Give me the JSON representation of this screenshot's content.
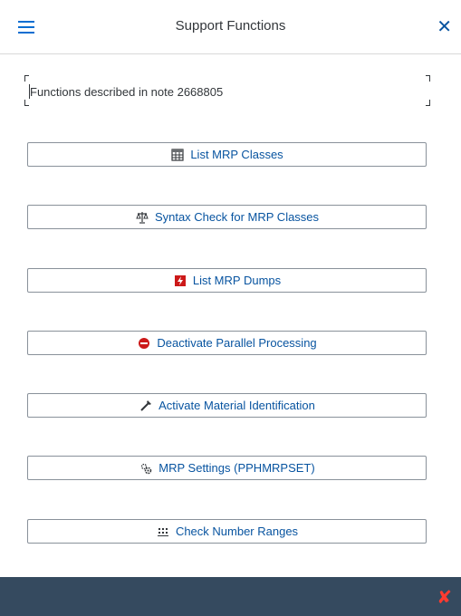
{
  "header": {
    "title": "Support Functions",
    "menu_icon": "hamburger-menu-icon",
    "close_icon": "close-icon",
    "accent": "#0a6ed1"
  },
  "note": {
    "text": "Functions described in note 2668805"
  },
  "buttons": [
    {
      "label": "List MRP Classes",
      "icon": "table-list-icon"
    },
    {
      "label": "Syntax Check for MRP Classes",
      "icon": "scales-icon"
    },
    {
      "label": "List MRP Dumps",
      "icon": "dump-error-icon"
    },
    {
      "label": "Deactivate Parallel Processing",
      "icon": "stop-sign-icon"
    },
    {
      "label": "Activate Material Identification",
      "icon": "wand-icon"
    },
    {
      "label": "MRP Settings (PPHMRPSET)",
      "icon": "gears-icon"
    },
    {
      "label": "Check Number Ranges",
      "icon": "number-range-icon"
    }
  ],
  "footer": {
    "close_icon": "cancel-icon",
    "background": "#354a5f",
    "close_color": "#ff3b30"
  }
}
